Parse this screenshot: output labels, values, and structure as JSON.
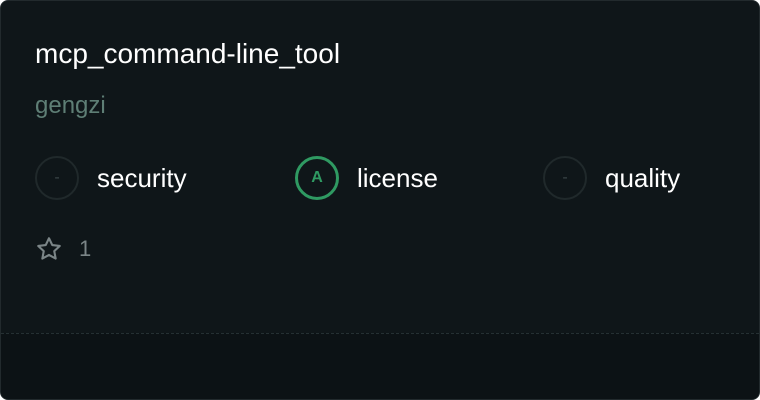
{
  "card": {
    "title": "mcp_command-line_tool",
    "author": "gengzi",
    "scores": [
      {
        "badge": "-",
        "label": "security"
      },
      {
        "badge": "A",
        "label": "license"
      },
      {
        "badge": "-",
        "label": "quality"
      }
    ],
    "stars": {
      "icon": "star-icon",
      "count": "1"
    }
  },
  "colors": {
    "background": "#0f1619",
    "author": "#5e7e75",
    "grade_a": "#2f9a62",
    "no_grade_border": "#20292b"
  }
}
